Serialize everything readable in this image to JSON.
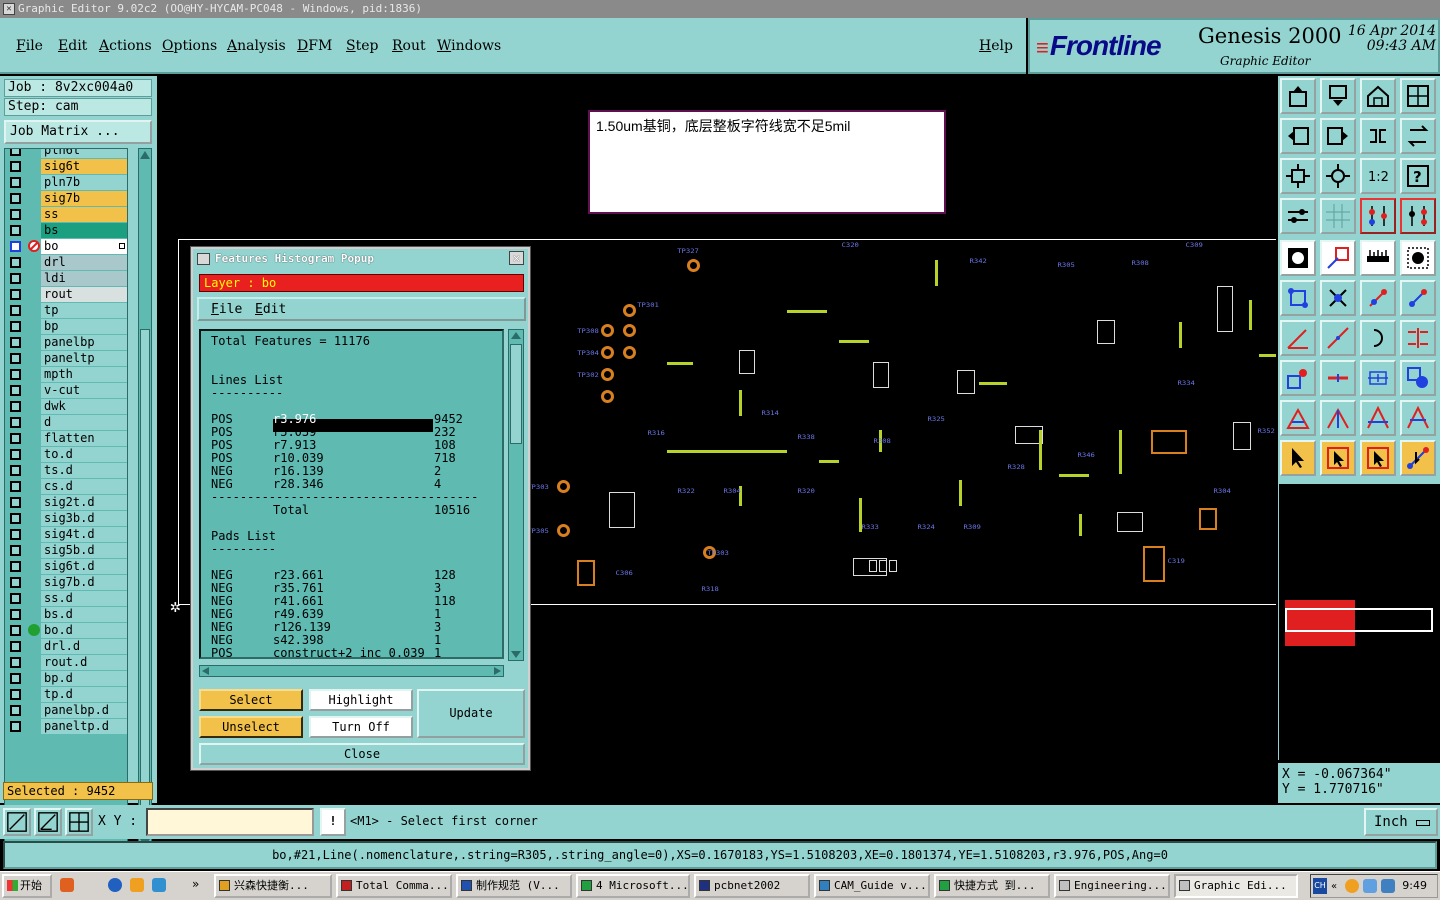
{
  "window": {
    "title": "Graphic Editor 9.02c2  (OO@HY-HYCAM-PC048 - Windows, pid:1836)"
  },
  "menu": {
    "items": [
      "File",
      "Edit",
      "Actions",
      "Options",
      "Analysis",
      "DFM",
      "Step",
      "Rout",
      "Windows"
    ],
    "help": "Help"
  },
  "brand": {
    "logo": "Frontline",
    "product": "Genesis 2000",
    "subtitle": "Graphic Editor",
    "date": "16 Apr 2014",
    "time": "09:43 AM"
  },
  "job": {
    "job": "Job : 8v2xc004a0",
    "step": "Step: cam",
    "matrix_button": "Job Matrix ..."
  },
  "layers": [
    {
      "name": "pln6t",
      "color": "#93d4d0"
    },
    {
      "name": "sig6t",
      "color": "#f2c14a"
    },
    {
      "name": "pln7b",
      "color": "#93d4d0"
    },
    {
      "name": "sig7b",
      "color": "#f2c14a"
    },
    {
      "name": "ss",
      "color": "#f2c14a"
    },
    {
      "name": "bs",
      "color": "#1aa080"
    },
    {
      "name": "bo",
      "color": "#ffffff",
      "active": true
    },
    {
      "name": "drl",
      "color": "#a8c8cc"
    },
    {
      "name": "ldi",
      "color": "#a8c8cc"
    },
    {
      "name": "rout",
      "color": "#d8e0e0"
    },
    {
      "name": "tp",
      "color": "#93d4d0"
    },
    {
      "name": "bp",
      "color": "#93d4d0"
    },
    {
      "name": "panelbp",
      "color": "#93d4d0"
    },
    {
      "name": "paneltp",
      "color": "#93d4d0"
    },
    {
      "name": "mpth",
      "color": "#93d4d0"
    },
    {
      "name": "v-cut",
      "color": "#93d4d0"
    },
    {
      "name": "dwk",
      "color": "#93d4d0"
    },
    {
      "name": "d",
      "color": "#93d4d0"
    },
    {
      "name": "flatten",
      "color": "#93d4d0"
    },
    {
      "name": "to.d",
      "color": "#93d4d0"
    },
    {
      "name": "ts.d",
      "color": "#93d4d0"
    },
    {
      "name": "cs.d",
      "color": "#93d4d0"
    },
    {
      "name": "sig2t.d",
      "color": "#93d4d0"
    },
    {
      "name": "sig3b.d",
      "color": "#93d4d0"
    },
    {
      "name": "sig4t.d",
      "color": "#93d4d0"
    },
    {
      "name": "sig5b.d",
      "color": "#93d4d0"
    },
    {
      "name": "sig6t.d",
      "color": "#93d4d0"
    },
    {
      "name": "sig7b.d",
      "color": "#93d4d0"
    },
    {
      "name": "ss.d",
      "color": "#93d4d0"
    },
    {
      "name": "bs.d",
      "color": "#93d4d0"
    },
    {
      "name": "bo.d",
      "color": "#93d4d0",
      "marker": "dot"
    },
    {
      "name": "drl.d",
      "color": "#93d4d0"
    },
    {
      "name": "rout.d",
      "color": "#93d4d0"
    },
    {
      "name": "bp.d",
      "color": "#93d4d0"
    },
    {
      "name": "tp.d",
      "color": "#93d4d0"
    },
    {
      "name": "panelbp.d",
      "color": "#93d4d0"
    },
    {
      "name": "paneltp.d",
      "color": "#93d4d0"
    }
  ],
  "selected": "Selected : 9452",
  "canvas": {
    "note": "1.50um基铜，底层整板字符线宽不足5mil"
  },
  "popup": {
    "title": "Features Histogram Popup",
    "layer": "Layer :  bo",
    "menu": [
      "File",
      "Edit"
    ],
    "total_features": "Total Features = 11176",
    "lines_title": "Lines List",
    "divider_short": "----------",
    "lines": [
      {
        "pol": "POS",
        "sym": "r3.976",
        "count": "9452",
        "selected": true
      },
      {
        "pol": "POS",
        "sym": "r5.039",
        "count": "232"
      },
      {
        "pol": "POS",
        "sym": "r7.913",
        "count": "108"
      },
      {
        "pol": "POS",
        "sym": "r10.039",
        "count": "718"
      },
      {
        "pol": "NEG",
        "sym": "r16.139",
        "count": "2"
      },
      {
        "pol": "NEG",
        "sym": "r28.346",
        "count": "4"
      }
    ],
    "divider_long": "-------------------------------------",
    "total_label": "Total",
    "total_value": "10516",
    "pads_title": "Pads List",
    "divider_pads": "---------",
    "pads": [
      {
        "pol": "NEG",
        "sym": "r23.661",
        "count": "128"
      },
      {
        "pol": "NEG",
        "sym": "r35.761",
        "count": "3"
      },
      {
        "pol": "NEG",
        "sym": "r41.661",
        "count": "118"
      },
      {
        "pol": "NEG",
        "sym": "r49.639",
        "count": "1"
      },
      {
        "pol": "NEG",
        "sym": "r126.139",
        "count": "3"
      },
      {
        "pol": "NEG",
        "sym": "s42.398",
        "count": "1"
      },
      {
        "pol": "POS",
        "sym": "construct+2_inc_0.039",
        "count": "1"
      }
    ],
    "buttons": {
      "select": "Select",
      "highlight": "Highlight",
      "unselect": "Unselect",
      "turn_off": "Turn Off",
      "update": "Update",
      "close": "Close"
    }
  },
  "coords": {
    "x": "X  =  -0.067364\"",
    "y": "Y  =  1.770716\""
  },
  "command": {
    "xy_label": "X Y :",
    "xy_value": "",
    "warn": "!",
    "prompt": "<M1> - Select first corner",
    "unit": "Inch"
  },
  "status": "bo,#21,Line(.nomenclature,.string=R305,.string_angle=0),XS=0.1670183,YS=1.5108203,XE=0.1801374,YE=1.5108203,r3.976,POS,Ang=0",
  "taskbar": {
    "start": "开始",
    "tasks": [
      "兴森快捷衡...",
      "Total Comma...",
      "制作规范 (V...",
      "4 Microsoft...",
      "pcbnet2002",
      "CAM_Guide v...",
      "快捷方式 到...",
      "Engineering...",
      "Graphic Edi..."
    ],
    "clock": "9:49",
    "tray_text": "CH"
  },
  "colors": {
    "panel": "#93d4d0",
    "accent_orange": "#f2c14a",
    "layer_red": "#e82020",
    "silk_yellow": "#b8d22a",
    "pad_orange": "#d88020",
    "label_blue": "#6c78e8"
  }
}
